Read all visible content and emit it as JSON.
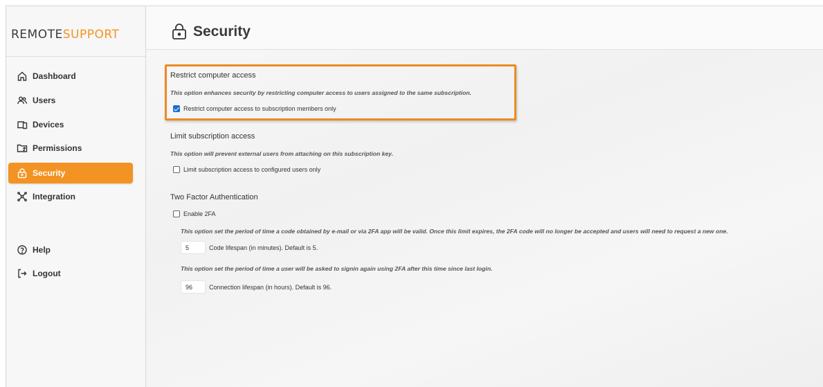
{
  "brand": {
    "part1": "REMOTE",
    "part2": "SUPPORT"
  },
  "sidebar": {
    "items": [
      {
        "label": "Dashboard",
        "icon": "home-icon"
      },
      {
        "label": "Users",
        "icon": "users-icon"
      },
      {
        "label": "Devices",
        "icon": "devices-icon"
      },
      {
        "label": "Permissions",
        "icon": "permissions-icon"
      },
      {
        "label": "Security",
        "icon": "lock-icon",
        "active": true
      },
      {
        "label": "Integration",
        "icon": "network-icon"
      }
    ],
    "footer_items": [
      {
        "label": "Help",
        "icon": "help-icon"
      },
      {
        "label": "Logout",
        "icon": "logout-icon"
      }
    ]
  },
  "header": {
    "title": "Security"
  },
  "sections": {
    "restrict": {
      "title": "Restrict computer access",
      "description": "This option enhances security by restricting computer access to users assigned to the same subscription.",
      "checkbox_label": "Restrict computer access to subscription members only",
      "checked": true
    },
    "limit": {
      "title": "Limit subscription access",
      "description": "This option will prevent external users from attaching on this subscription key.",
      "checkbox_label": "Limit subscription access to configured users only",
      "checked": false
    },
    "twofa": {
      "title": "Two Factor Authentication",
      "checkbox_label": "Enable 2FA",
      "checked": false,
      "code_description": "This option set the period of time a code obtained by e-mail or via 2FA app will be valid. Once this limit expires, the 2FA code will no longer be accepted and users will need to request a new one.",
      "code_value": "5",
      "code_label": "Code lifespan (in minutes). Default is 5.",
      "connection_description": "This option set the period of time a user will be asked to signin again using 2FA after this time since last login.",
      "connection_value": "96",
      "connection_label": "Connection lifespan (in hours). Default is 96."
    }
  },
  "colors": {
    "accent": "#f39323",
    "highlight_border": "#ec8a23",
    "checkbox": "#1a6fd0"
  }
}
